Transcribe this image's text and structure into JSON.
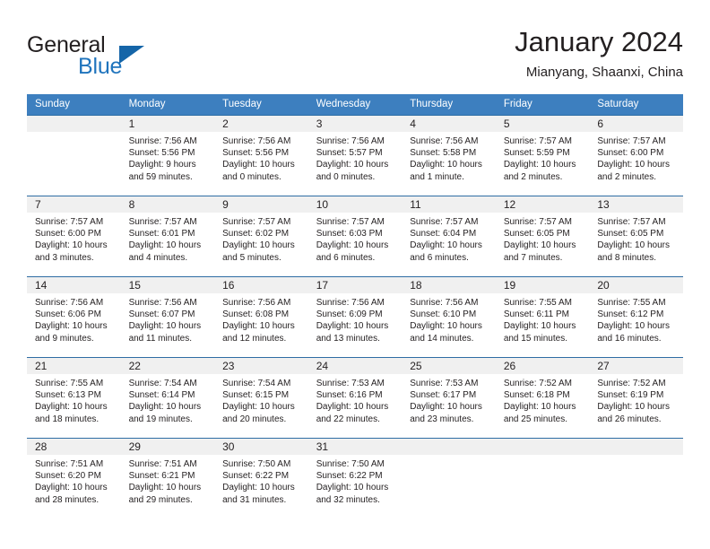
{
  "brand": {
    "name_part1": "General",
    "name_part2": "Blue",
    "logo_icon": "triangle-icon"
  },
  "header": {
    "title": "January 2024",
    "subtitle": "Mianyang, Shaanxi, China"
  },
  "colors": {
    "header_blue": "#3d7fbf",
    "rule_blue": "#2e6da4",
    "daynum_band": "#f0f0f0",
    "brand_blue": "#1f74bd",
    "text": "#231f20"
  },
  "weekday_headers": [
    "Sunday",
    "Monday",
    "Tuesday",
    "Wednesday",
    "Thursday",
    "Friday",
    "Saturday"
  ],
  "weeks": [
    [
      {
        "day": "",
        "sunrise": "",
        "sunset": "",
        "daylight_line1": "",
        "daylight_line2": ""
      },
      {
        "day": "1",
        "sunrise": "Sunrise: 7:56 AM",
        "sunset": "Sunset: 5:56 PM",
        "daylight_line1": "Daylight: 9 hours",
        "daylight_line2": "and 59 minutes."
      },
      {
        "day": "2",
        "sunrise": "Sunrise: 7:56 AM",
        "sunset": "Sunset: 5:56 PM",
        "daylight_line1": "Daylight: 10 hours",
        "daylight_line2": "and 0 minutes."
      },
      {
        "day": "3",
        "sunrise": "Sunrise: 7:56 AM",
        "sunset": "Sunset: 5:57 PM",
        "daylight_line1": "Daylight: 10 hours",
        "daylight_line2": "and 0 minutes."
      },
      {
        "day": "4",
        "sunrise": "Sunrise: 7:56 AM",
        "sunset": "Sunset: 5:58 PM",
        "daylight_line1": "Daylight: 10 hours",
        "daylight_line2": "and 1 minute."
      },
      {
        "day": "5",
        "sunrise": "Sunrise: 7:57 AM",
        "sunset": "Sunset: 5:59 PM",
        "daylight_line1": "Daylight: 10 hours",
        "daylight_line2": "and 2 minutes."
      },
      {
        "day": "6",
        "sunrise": "Sunrise: 7:57 AM",
        "sunset": "Sunset: 6:00 PM",
        "daylight_line1": "Daylight: 10 hours",
        "daylight_line2": "and 2 minutes."
      }
    ],
    [
      {
        "day": "7",
        "sunrise": "Sunrise: 7:57 AM",
        "sunset": "Sunset: 6:00 PM",
        "daylight_line1": "Daylight: 10 hours",
        "daylight_line2": "and 3 minutes."
      },
      {
        "day": "8",
        "sunrise": "Sunrise: 7:57 AM",
        "sunset": "Sunset: 6:01 PM",
        "daylight_line1": "Daylight: 10 hours",
        "daylight_line2": "and 4 minutes."
      },
      {
        "day": "9",
        "sunrise": "Sunrise: 7:57 AM",
        "sunset": "Sunset: 6:02 PM",
        "daylight_line1": "Daylight: 10 hours",
        "daylight_line2": "and 5 minutes."
      },
      {
        "day": "10",
        "sunrise": "Sunrise: 7:57 AM",
        "sunset": "Sunset: 6:03 PM",
        "daylight_line1": "Daylight: 10 hours",
        "daylight_line2": "and 6 minutes."
      },
      {
        "day": "11",
        "sunrise": "Sunrise: 7:57 AM",
        "sunset": "Sunset: 6:04 PM",
        "daylight_line1": "Daylight: 10 hours",
        "daylight_line2": "and 6 minutes."
      },
      {
        "day": "12",
        "sunrise": "Sunrise: 7:57 AM",
        "sunset": "Sunset: 6:05 PM",
        "daylight_line1": "Daylight: 10 hours",
        "daylight_line2": "and 7 minutes."
      },
      {
        "day": "13",
        "sunrise": "Sunrise: 7:57 AM",
        "sunset": "Sunset: 6:05 PM",
        "daylight_line1": "Daylight: 10 hours",
        "daylight_line2": "and 8 minutes."
      }
    ],
    [
      {
        "day": "14",
        "sunrise": "Sunrise: 7:56 AM",
        "sunset": "Sunset: 6:06 PM",
        "daylight_line1": "Daylight: 10 hours",
        "daylight_line2": "and 9 minutes."
      },
      {
        "day": "15",
        "sunrise": "Sunrise: 7:56 AM",
        "sunset": "Sunset: 6:07 PM",
        "daylight_line1": "Daylight: 10 hours",
        "daylight_line2": "and 11 minutes."
      },
      {
        "day": "16",
        "sunrise": "Sunrise: 7:56 AM",
        "sunset": "Sunset: 6:08 PM",
        "daylight_line1": "Daylight: 10 hours",
        "daylight_line2": "and 12 minutes."
      },
      {
        "day": "17",
        "sunrise": "Sunrise: 7:56 AM",
        "sunset": "Sunset: 6:09 PM",
        "daylight_line1": "Daylight: 10 hours",
        "daylight_line2": "and 13 minutes."
      },
      {
        "day": "18",
        "sunrise": "Sunrise: 7:56 AM",
        "sunset": "Sunset: 6:10 PM",
        "daylight_line1": "Daylight: 10 hours",
        "daylight_line2": "and 14 minutes."
      },
      {
        "day": "19",
        "sunrise": "Sunrise: 7:55 AM",
        "sunset": "Sunset: 6:11 PM",
        "daylight_line1": "Daylight: 10 hours",
        "daylight_line2": "and 15 minutes."
      },
      {
        "day": "20",
        "sunrise": "Sunrise: 7:55 AM",
        "sunset": "Sunset: 6:12 PM",
        "daylight_line1": "Daylight: 10 hours",
        "daylight_line2": "and 16 minutes."
      }
    ],
    [
      {
        "day": "21",
        "sunrise": "Sunrise: 7:55 AM",
        "sunset": "Sunset: 6:13 PM",
        "daylight_line1": "Daylight: 10 hours",
        "daylight_line2": "and 18 minutes."
      },
      {
        "day": "22",
        "sunrise": "Sunrise: 7:54 AM",
        "sunset": "Sunset: 6:14 PM",
        "daylight_line1": "Daylight: 10 hours",
        "daylight_line2": "and 19 minutes."
      },
      {
        "day": "23",
        "sunrise": "Sunrise: 7:54 AM",
        "sunset": "Sunset: 6:15 PM",
        "daylight_line1": "Daylight: 10 hours",
        "daylight_line2": "and 20 minutes."
      },
      {
        "day": "24",
        "sunrise": "Sunrise: 7:53 AM",
        "sunset": "Sunset: 6:16 PM",
        "daylight_line1": "Daylight: 10 hours",
        "daylight_line2": "and 22 minutes."
      },
      {
        "day": "25",
        "sunrise": "Sunrise: 7:53 AM",
        "sunset": "Sunset: 6:17 PM",
        "daylight_line1": "Daylight: 10 hours",
        "daylight_line2": "and 23 minutes."
      },
      {
        "day": "26",
        "sunrise": "Sunrise: 7:52 AM",
        "sunset": "Sunset: 6:18 PM",
        "daylight_line1": "Daylight: 10 hours",
        "daylight_line2": "and 25 minutes."
      },
      {
        "day": "27",
        "sunrise": "Sunrise: 7:52 AM",
        "sunset": "Sunset: 6:19 PM",
        "daylight_line1": "Daylight: 10 hours",
        "daylight_line2": "and 26 minutes."
      }
    ],
    [
      {
        "day": "28",
        "sunrise": "Sunrise: 7:51 AM",
        "sunset": "Sunset: 6:20 PM",
        "daylight_line1": "Daylight: 10 hours",
        "daylight_line2": "and 28 minutes."
      },
      {
        "day": "29",
        "sunrise": "Sunrise: 7:51 AM",
        "sunset": "Sunset: 6:21 PM",
        "daylight_line1": "Daylight: 10 hours",
        "daylight_line2": "and 29 minutes."
      },
      {
        "day": "30",
        "sunrise": "Sunrise: 7:50 AM",
        "sunset": "Sunset: 6:22 PM",
        "daylight_line1": "Daylight: 10 hours",
        "daylight_line2": "and 31 minutes."
      },
      {
        "day": "31",
        "sunrise": "Sunrise: 7:50 AM",
        "sunset": "Sunset: 6:22 PM",
        "daylight_line1": "Daylight: 10 hours",
        "daylight_line2": "and 32 minutes."
      },
      {
        "day": "",
        "sunrise": "",
        "sunset": "",
        "daylight_line1": "",
        "daylight_line2": ""
      },
      {
        "day": "",
        "sunrise": "",
        "sunset": "",
        "daylight_line1": "",
        "daylight_line2": ""
      },
      {
        "day": "",
        "sunrise": "",
        "sunset": "",
        "daylight_line1": "",
        "daylight_line2": ""
      }
    ]
  ]
}
